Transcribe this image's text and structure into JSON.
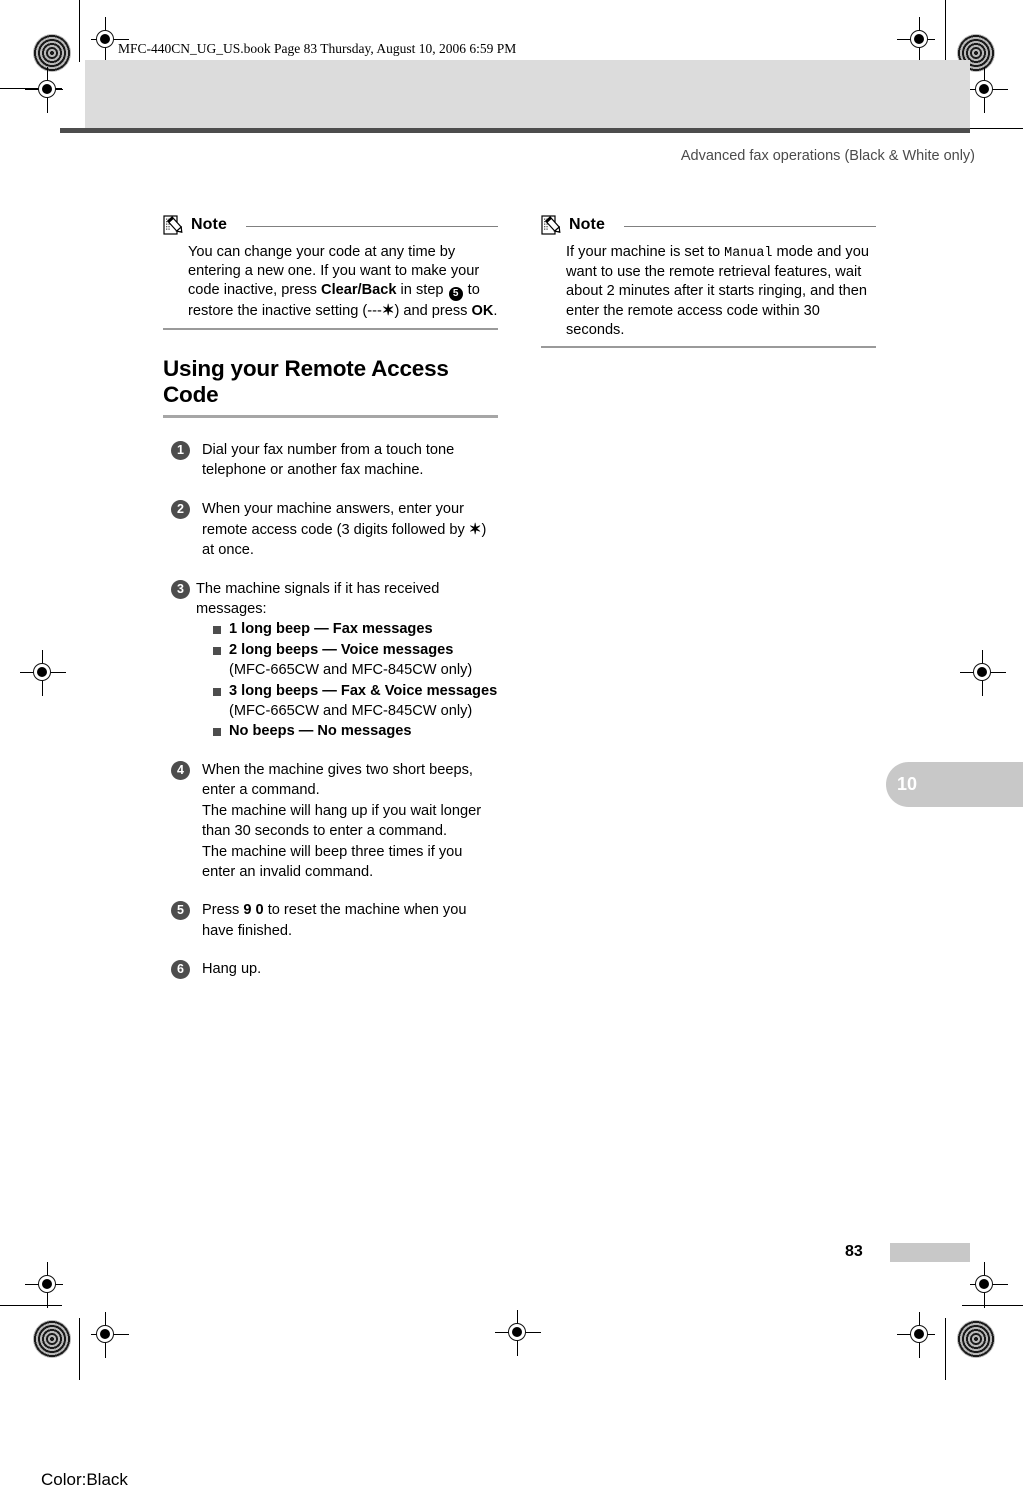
{
  "print_marks": {
    "file_slug": "MFC-440CN_UG_US.book  Page 83  Thursday, August 10, 2006  6:59 PM",
    "color_slug": "Color:Black"
  },
  "running_head": {
    "title": "Advanced fax operations (Black & White only)"
  },
  "chapter_tab": {
    "number": "10"
  },
  "footer": {
    "page_number": "83"
  },
  "notes": {
    "left": {
      "label": "Note",
      "icon": "note-pencil-icon",
      "text_part_1": "You can change your code at any time by entering a new one. If you want to make your code inactive, press ",
      "bold_1": "Clear/Back",
      "text_part_2": " in step ",
      "circled_step": "5",
      "text_part_3": " to restore the inactive setting (---",
      "star": "✶",
      "text_part_4": ") and press ",
      "bold_2": "OK",
      "text_part_5": "."
    },
    "right": {
      "label": "Note",
      "icon": "note-pencil-icon",
      "text_part_1": "If your machine is set to ",
      "mono_1": "Manual",
      "text_part_2": " mode and you want to use the remote retrieval features, wait about 2 minutes after it starts ringing, and then enter the remote access code within 30 seconds."
    }
  },
  "section": {
    "heading": "Using your Remote Access Code"
  },
  "steps": [
    {
      "number": "1",
      "text": "Dial your fax number from a touch tone telephone or another fax machine."
    },
    {
      "number": "2",
      "text_part_1": "When your machine answers, enter your remote access code (3 digits followed by ",
      "star": "✶",
      "text_part_2": ") at once."
    },
    {
      "number": "3",
      "text": "The machine signals if it has received messages:",
      "bullets": [
        {
          "strong": "1 long beep — Fax messages",
          "plain": ""
        },
        {
          "strong": "2 long beeps — Voice messages",
          "plain": "(MFC-665CW and MFC-845CW only)"
        },
        {
          "strong": "3 long beeps — Fax & Voice messages",
          "plain": "(MFC-665CW and MFC-845CW only)"
        },
        {
          "strong": "No beeps — No messages",
          "plain": ""
        }
      ]
    },
    {
      "number": "4",
      "line_1": "When the machine gives two short beeps, enter a command.",
      "line_2": "The machine will hang up if you wait longer than 30 seconds to enter a command.",
      "line_3": "The machine will beep three times if you enter an invalid command."
    },
    {
      "number": "5",
      "text_part_1": "Press ",
      "bold_1": "9 0",
      "text_part_2": " to reset the machine when you have finished."
    },
    {
      "number": "6",
      "text": "Hang up."
    }
  ]
}
